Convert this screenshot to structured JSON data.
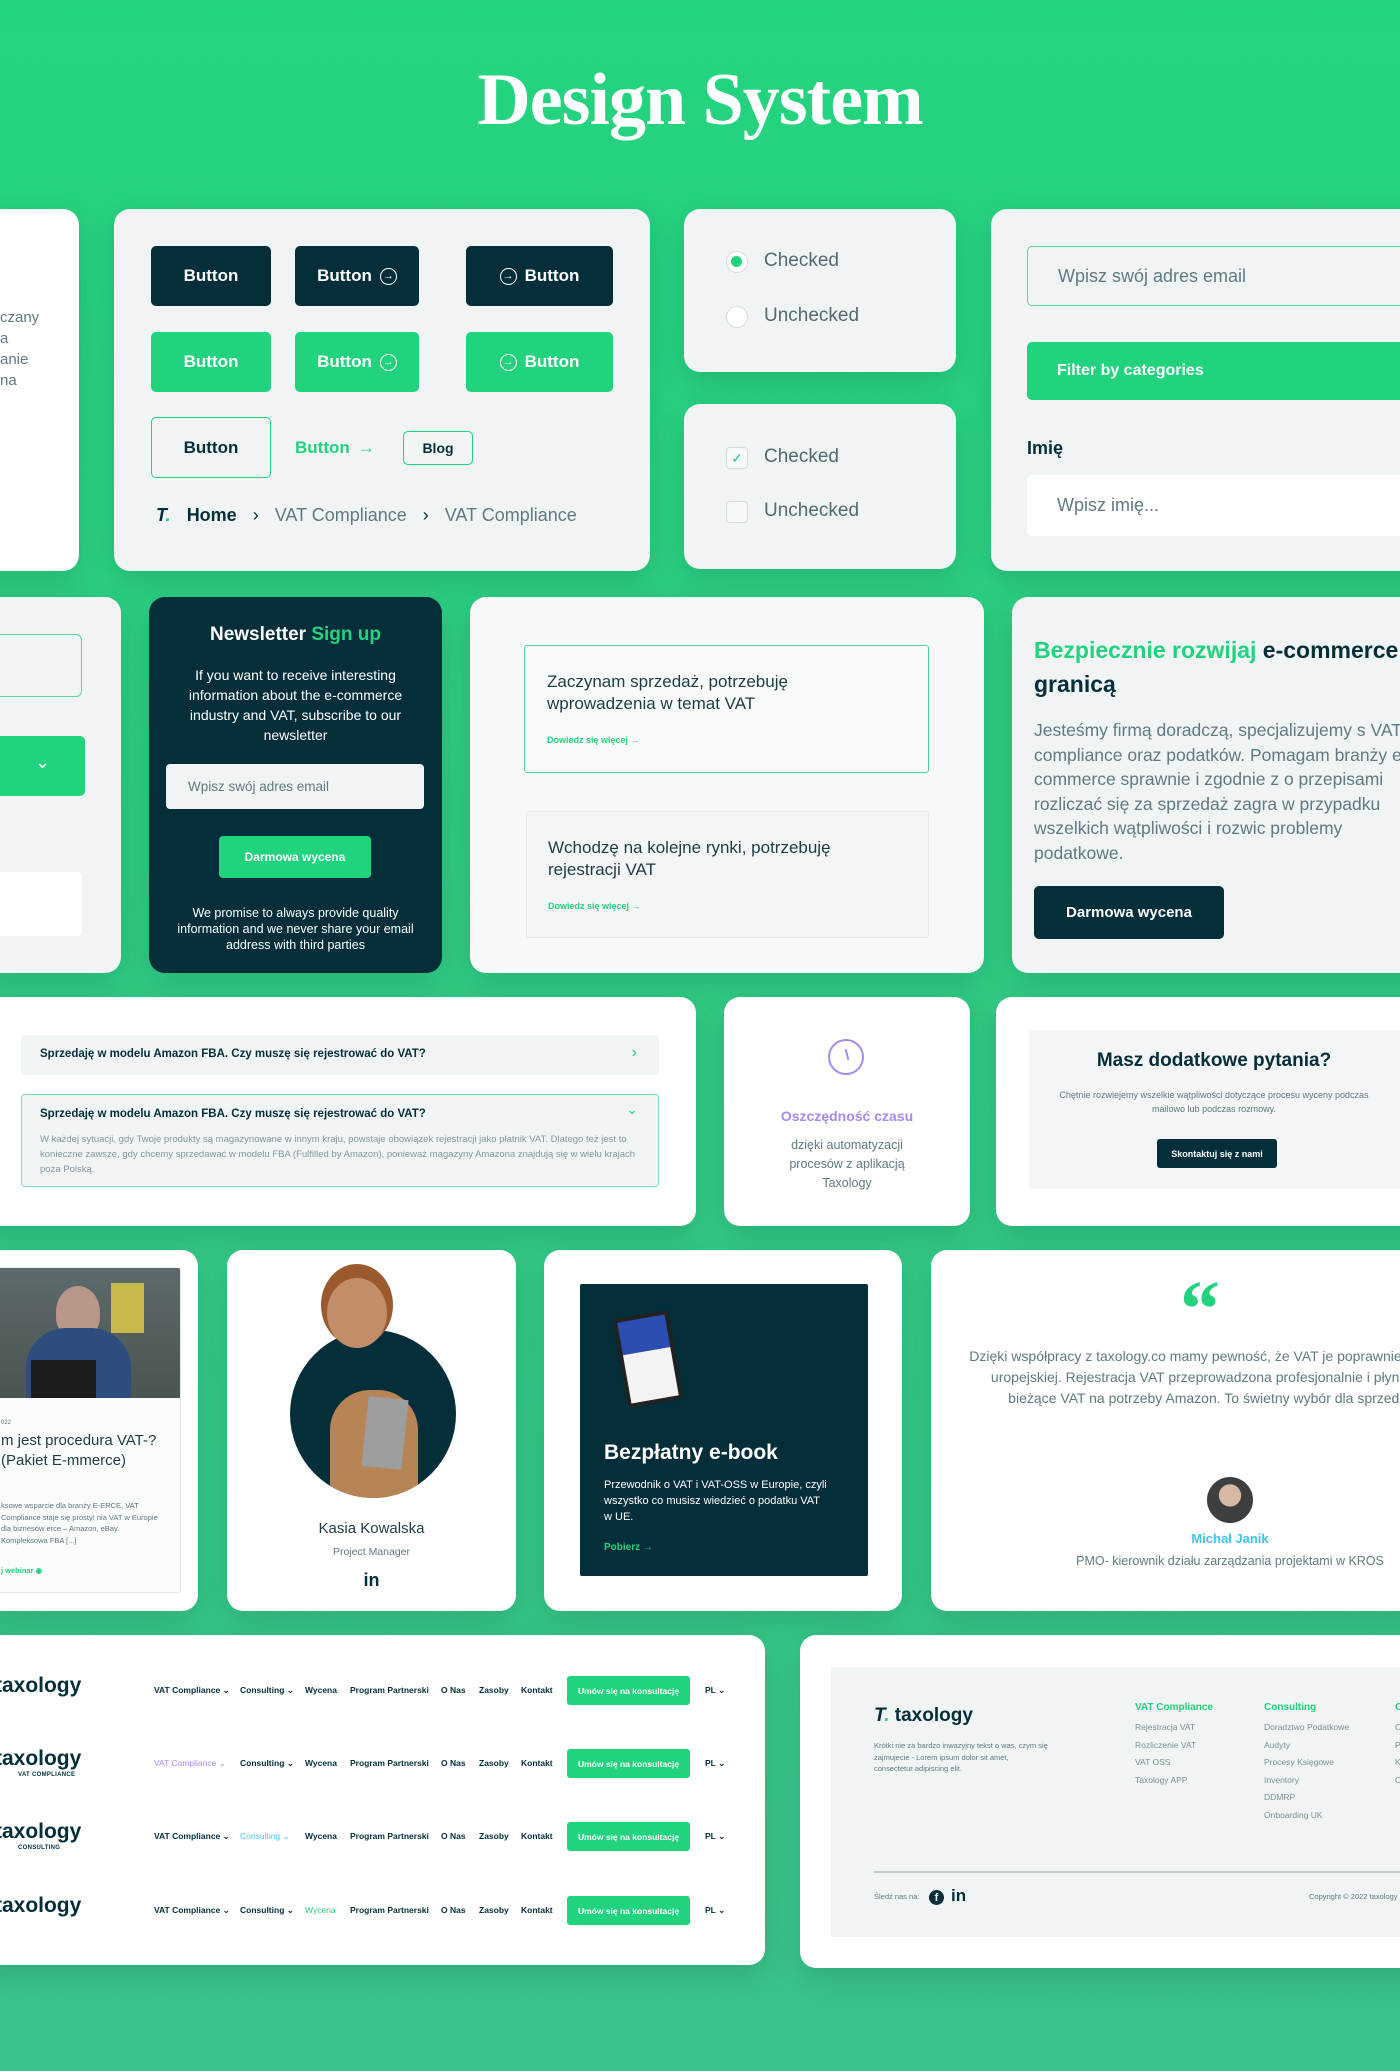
{
  "page_title": "Design System",
  "colors": {
    "primary_green": "#22d37d",
    "dark": "#032e3a",
    "purple": "#a58af0",
    "cyan": "#3dc5f0",
    "bg": "#f1f4f5"
  },
  "left_partial_text": [
    "czany",
    "a",
    "anie",
    "na"
  ],
  "buttons": {
    "label": "Button",
    "blog": "Blog",
    "icon": "arrow-circle-right-icon"
  },
  "breadcrumb": {
    "home": "Home",
    "items": [
      "VAT Compliance",
      "VAT Compliance"
    ]
  },
  "radios": [
    {
      "label": "Checked",
      "checked": true
    },
    {
      "label": "Unchecked",
      "checked": false
    }
  ],
  "checkboxes": [
    {
      "label": "Checked",
      "checked": true
    },
    {
      "label": "Unchecked",
      "checked": false
    }
  ],
  "form": {
    "email_placeholder": "Wpisz swój adres email",
    "filter_label": "Filter by categories",
    "name_label": "Imię",
    "name_placeholder": "Wpisz imię..."
  },
  "newsletter": {
    "title": "Newsletter",
    "title_accent": "Sign up",
    "text": "If you want to receive interesting information about the e-commerce industry and VAT, subscribe to our newsletter",
    "email_placeholder": "Wpisz swój adres email",
    "button": "Darmowa wycena",
    "note": "We promise to always provide quality information and we never share your email address with third parties"
  },
  "options": [
    {
      "title": "Zaczynam sprzedaż, potrzebuję wprowadzenia w temat VAT",
      "link": "Dowiedz się więcej"
    },
    {
      "title": "Wchodzę na kolejne rynki,  potrzebuję rejestracji VAT",
      "link": "Dowiedz się więcej"
    }
  ],
  "hero": {
    "title_accent": "Bezpiecznie rozwijaj",
    "title_rest": "e-commerce",
    "title_line2": "granicą",
    "text": "Jesteśmy firmą doradczą, specjalizujemy s VAT compliance oraz podatków. Pomagam branży e-commerce sprawnie i zgodnie z o przepisami rozliczać się za sprzedaż zagra w przypadku wszelkich wątpliwości i rozwic problemy podatkowe.",
    "button": "Darmowa wycena"
  },
  "faq": [
    {
      "question": "Sprzedaję w modelu Amazon FBA. Czy muszę się rejestrować do VAT?",
      "expanded": false
    },
    {
      "question": "Sprzedaję w modelu Amazon FBA. Czy muszę się rejestrować do VAT?",
      "expanded": true,
      "answer": "W każdej sytuacji, gdy Twoje produkty są magazynowane w innym kraju, powstaje obowiązek rejestracji jako płatnik VAT. Dlatego też jest to konieczne zawsze, gdy chcemy sprzedawać w modelu FBA (Fulfilled by Amazon), ponieważ magazyny Amazona znajdują się w wielu krajach poza Polską."
    }
  ],
  "feature": {
    "icon": "clock-icon",
    "title": "Oszczędność czasu",
    "text": "dzięki automatyzacji procesów z aplikacją Taxology"
  },
  "contact": {
    "title": "Masz dodatkowe pytania?",
    "text": "Chętnie rozwiejemy wszelkie wątpliwości dotyczące procesu wyceny podczas mailowo lub podczas rozmowy.",
    "button": "Skontaktuj się z nami"
  },
  "webinar": {
    "date": "022",
    "title": "m jest procedura VAT-? (Pakiet E-mmerce)",
    "text": "ksowe wsparcie dla branży E-ERCE, VAT Compliance staje się prosty! nia VAT w Europie dla biznesów erce – Amazon, eBay. Kompleksowa FBA [...]",
    "link": "j webinar"
  },
  "person": {
    "name": "Kasia Kowalska",
    "role": "Project Manager",
    "social": "in"
  },
  "ebook": {
    "title": "Bezpłatny e-book",
    "text": "Przewodnik o VAT i VAT-OSS w Europie, czyli wszystko co musisz wiedzieć o podatku VAT w UE.",
    "link": "Pobierz"
  },
  "testimonial": {
    "quote": "Dzięki współpracy z taxology.co mamy pewność, że VAT je poprawnie w krajach Unii uropejskiej. Rejestracja VAT przeprowadzona profesjonalnie i płynnie, a także bieżące VAT na potrzeby Amazon. To świetny wybór dla sprzed Amazon",
    "name": "Michał Janik",
    "role": "PMO- kierownik działu zarządzania projektami w KROS"
  },
  "nav": {
    "logo": "taxology",
    "items": [
      "VAT Compliance",
      "Consulting",
      "Wycena",
      "Program Partnerski",
      "O Nas",
      "Zasoby",
      "Kontakt"
    ],
    "dropdown_items": [
      0,
      1
    ],
    "cta": "Umów się na konsultację",
    "lang": "PL",
    "variants": [
      {
        "subtitle": "",
        "active": -1
      },
      {
        "subtitle": "VAT COMPLIANCE",
        "active": 0,
        "color": "#a58af0"
      },
      {
        "subtitle": "CONSULTING",
        "active": 1,
        "color": "#3dc5f0"
      },
      {
        "subtitle": "",
        "active": 2,
        "color": "#22d37d"
      }
    ]
  },
  "footer": {
    "logo": "taxology",
    "text": "Krótki nie za bardzo inwazyjny tekst o was, czym się zajmujecie - Lorem ipsum dolor sit amet, consectetur adipiscing elit.",
    "columns": [
      {
        "title": "VAT Compliance",
        "links": [
          "Rejestracja VAT",
          "Rozliczenie VAT",
          "VAT OSS",
          "Taxology APP"
        ]
      },
      {
        "title": "Consulting",
        "links": [
          "Doradztwo Podatkowe",
          "Audyty",
          "Procesy Księgowe",
          "Inventory",
          "DDMRP",
          "Onboarding UK"
        ]
      },
      {
        "title": "C",
        "links": [
          "C",
          "P",
          "K",
          "C"
        ]
      }
    ],
    "follow": "Śledź nas na:",
    "copyright": "Copyright © 2022 taxology"
  }
}
